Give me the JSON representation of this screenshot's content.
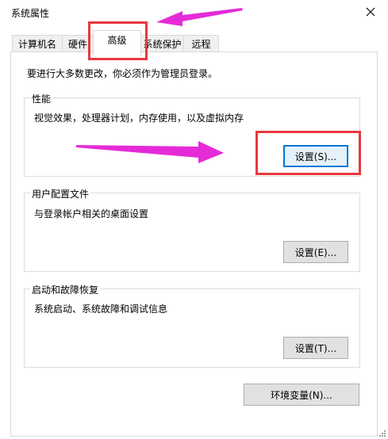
{
  "window": {
    "title": "系统属性"
  },
  "tabs": [
    {
      "label": "计算机名"
    },
    {
      "label": "硬件"
    },
    {
      "label": "高级"
    },
    {
      "label": "系统保护"
    },
    {
      "label": "远程"
    }
  ],
  "admin_note": "要进行大多数更改，你必须作为管理员登录。",
  "performance": {
    "title": "性能",
    "description": "视觉效果，处理器计划，内存使用，以及虚拟内存",
    "button": "设置(S)..."
  },
  "user_profiles": {
    "title": "用户配置文件",
    "description": "与登录帐户相关的桌面设置",
    "button": "设置(E)..."
  },
  "startup_recovery": {
    "title": "启动和故障恢复",
    "description": "系统启动、系统故障和调试信息",
    "button": "设置(T)..."
  },
  "env_button": "环境变量(N)...",
  "colors": {
    "highlight": "#e8383d",
    "arrow": "#e52bd8",
    "focus": "#0078d7"
  }
}
